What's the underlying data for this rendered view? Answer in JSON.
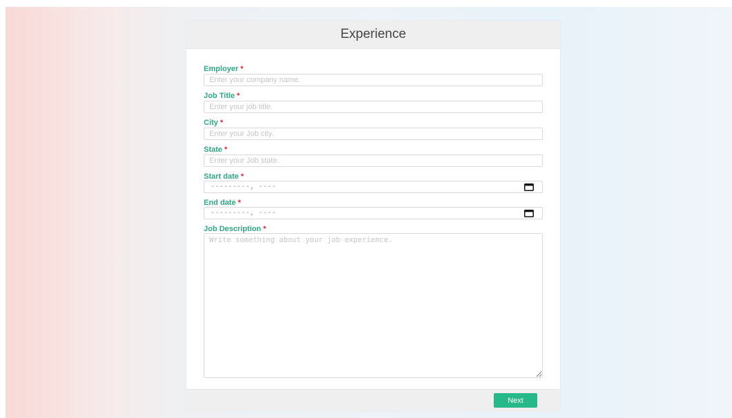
{
  "card": {
    "title": "Experience"
  },
  "fields": {
    "employer": {
      "label": "Employer",
      "required_mark": "*",
      "placeholder": "Enter your company name."
    },
    "job_title": {
      "label": "Job Title",
      "required_mark": "*",
      "placeholder": "Enter your job title."
    },
    "city": {
      "label": "City",
      "required_mark": "*",
      "placeholder": "Enter your Job city."
    },
    "state": {
      "label": "State",
      "required_mark": "*",
      "placeholder": "Enter your Job state."
    },
    "start_date": {
      "label": "Start date",
      "required_mark": "*",
      "mask": "---------, ----"
    },
    "end_date": {
      "label": "End date",
      "required_mark": "*",
      "mask": "---------, ----"
    },
    "job_description": {
      "label": "Job Description",
      "required_mark": "*",
      "placeholder": "Write something about your job experience."
    }
  },
  "footer": {
    "next_label": "Next"
  },
  "icons": {
    "calendar": "calendar-icon"
  },
  "colors": {
    "label": "#2dab7e",
    "required": "#e0202a",
    "button": "#26b889",
    "header_bg": "#efefef"
  }
}
